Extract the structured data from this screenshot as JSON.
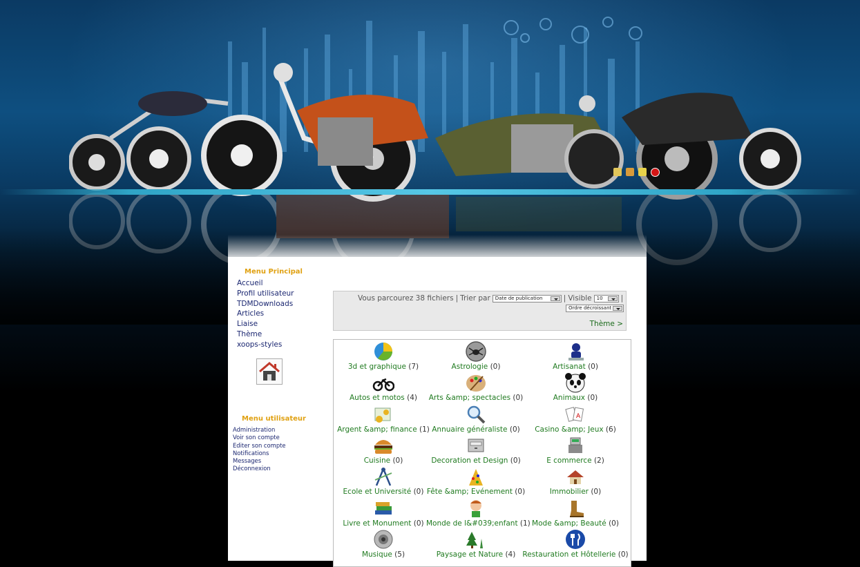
{
  "main_menu": {
    "title": "Menu Principal",
    "items": [
      "Accueil",
      "Profil utilisateur",
      "TDMDownloads",
      "Articles",
      "Liaise",
      "Thème",
      "xoops-styles"
    ]
  },
  "user_menu": {
    "title": "Menu utilisateur",
    "items": [
      "Administration",
      "Voir son compte",
      "Editer son compte",
      "Notifications",
      "Messages",
      "Déconnexion"
    ]
  },
  "browse": {
    "count_text": "Vous parcourez 38 fichiers",
    "sep1": "|",
    "sort_label": "Trier par",
    "sort_value": "Date de publication",
    "sep2": "|",
    "visible_label": "Visible",
    "visible_value": "10",
    "sep3": "|",
    "order_value": "Ordre décroissant",
    "theme_link": "Thème >"
  },
  "categories": [
    {
      "name": "3d et graphique",
      "count": "(7)",
      "icon": "pie-chart-icon"
    },
    {
      "name": "Astrologie",
      "count": "(0)",
      "icon": "spider-icon"
    },
    {
      "name": "Artisanat",
      "count": "(0)",
      "icon": "user-icon"
    },
    {
      "name": "Autos et motos",
      "count": "(4)",
      "icon": "motorcycle-icon"
    },
    {
      "name": "Arts &amp; spectacles",
      "count": "(0)",
      "icon": "palette-icon"
    },
    {
      "name": "Animaux",
      "count": "(0)",
      "icon": "panda-icon"
    },
    {
      "name": "Argent &amp; finance",
      "count": "(1)",
      "icon": "money-icon"
    },
    {
      "name": "Annuaire généraliste",
      "count": "(0)",
      "icon": "magnifier-icon"
    },
    {
      "name": "Casino &amp; Jeux",
      "count": "(6)",
      "icon": "cards-icon"
    },
    {
      "name": "Cuisine",
      "count": "(0)",
      "icon": "burger-icon"
    },
    {
      "name": "Decoration et Design",
      "count": "(0)",
      "icon": "drawer-icon"
    },
    {
      "name": "E commerce",
      "count": "(2)",
      "icon": "cash-register-icon"
    },
    {
      "name": "Ecole et Université",
      "count": "(0)",
      "icon": "compass-icon"
    },
    {
      "name": "Fête &amp; Evénement",
      "count": "(0)",
      "icon": "party-icon"
    },
    {
      "name": "Immobilier",
      "count": "(0)",
      "icon": "house-icon"
    },
    {
      "name": "Livre et Monument",
      "count": "(0)",
      "icon": "books-icon"
    },
    {
      "name": "Monde de l&#039;enfant",
      "count": "(1)",
      "icon": "child-icon"
    },
    {
      "name": "Mode &amp; Beauté",
      "count": "(0)",
      "icon": "boot-icon"
    },
    {
      "name": "Musique",
      "count": "(5)",
      "icon": "speaker-icon"
    },
    {
      "name": "Paysage et Nature",
      "count": "(4)",
      "icon": "tree-icon"
    },
    {
      "name": "Restauration et Hôtellerie",
      "count": "(0)",
      "icon": "fork-knife-icon"
    }
  ]
}
